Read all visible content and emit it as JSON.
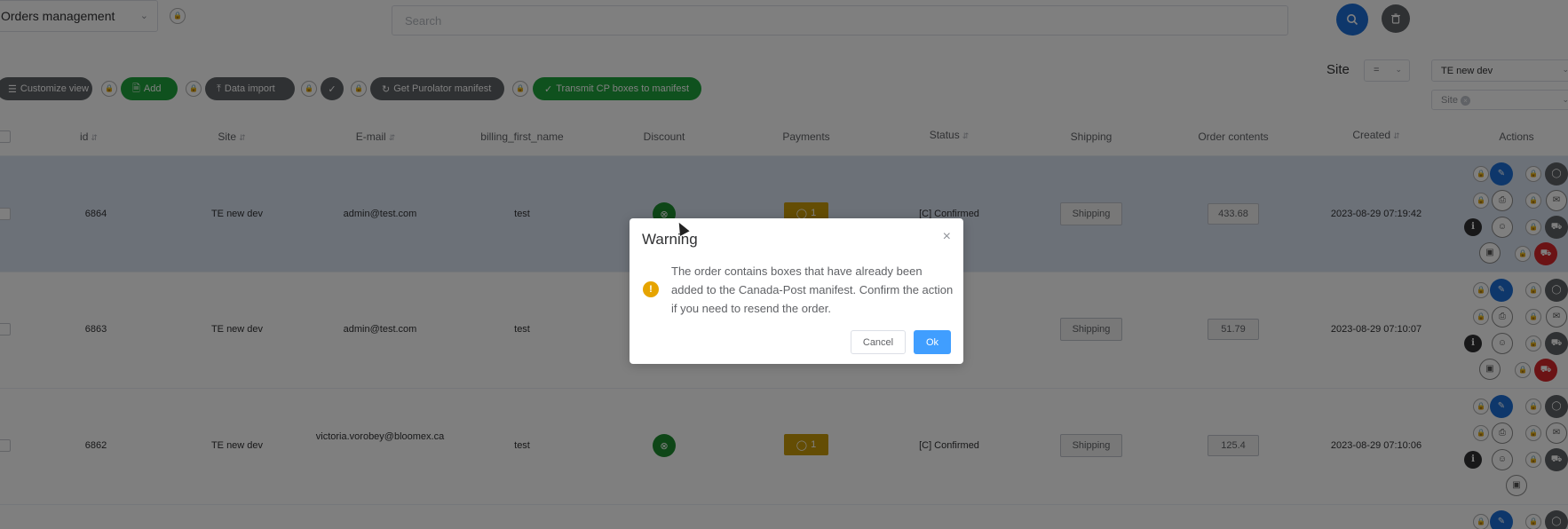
{
  "header": {
    "view_select": "Orders management",
    "search_placeholder": "Search"
  },
  "toolbar": {
    "customize_view": "Customize view",
    "add": "Add",
    "data_import": "Data import",
    "get_purolator_manifest": "Get Purolator manifest",
    "transmit_cp": "Transmit CP boxes to manifest"
  },
  "filters": {
    "site_label": "Site",
    "operator": "=",
    "site_value": "TE new dev",
    "site_placeholder": "Site"
  },
  "table": {
    "columns": [
      "id",
      "Site",
      "E-mail",
      "billing_first_name",
      "Discount",
      "Payments",
      "Status",
      "Shipping",
      "Order contents",
      "Created",
      "Actions"
    ],
    "rows": [
      {
        "id": "6864",
        "site": "TE new dev",
        "email": "admin@test.com",
        "first_name": "test",
        "payments": "1",
        "status": "[C] Confirmed",
        "shipping": "Shipping",
        "order_contents": "433.68",
        "created": "2023-08-29 07:19:42"
      },
      {
        "id": "6863",
        "site": "TE new dev",
        "email": "admin@test.com",
        "first_name": "test",
        "payments": "",
        "status": "firmed",
        "shipping": "Shipping",
        "order_contents": "51.79",
        "created": "2023-08-29 07:10:07"
      },
      {
        "id": "6862",
        "site": "TE new dev",
        "email": "victoria.vorobey@bloomex.ca",
        "first_name": "test",
        "payments": "1",
        "status": "[C] Confirmed",
        "shipping": "Shipping",
        "order_contents": "125.4",
        "created": "2023-08-29 07:10:06"
      }
    ]
  },
  "modal": {
    "title": "Warning",
    "message": "The order contains boxes that have already been added to the Canada-Post manifest. Confirm the action if you need to resend the order.",
    "cancel": "Cancel",
    "ok": "Ok"
  },
  "colors": {
    "primary": "#1d6fd6",
    "success": "#1fa33c",
    "warning": "#c99a08",
    "danger": "#d6262a",
    "modal_ok": "#409eff"
  }
}
